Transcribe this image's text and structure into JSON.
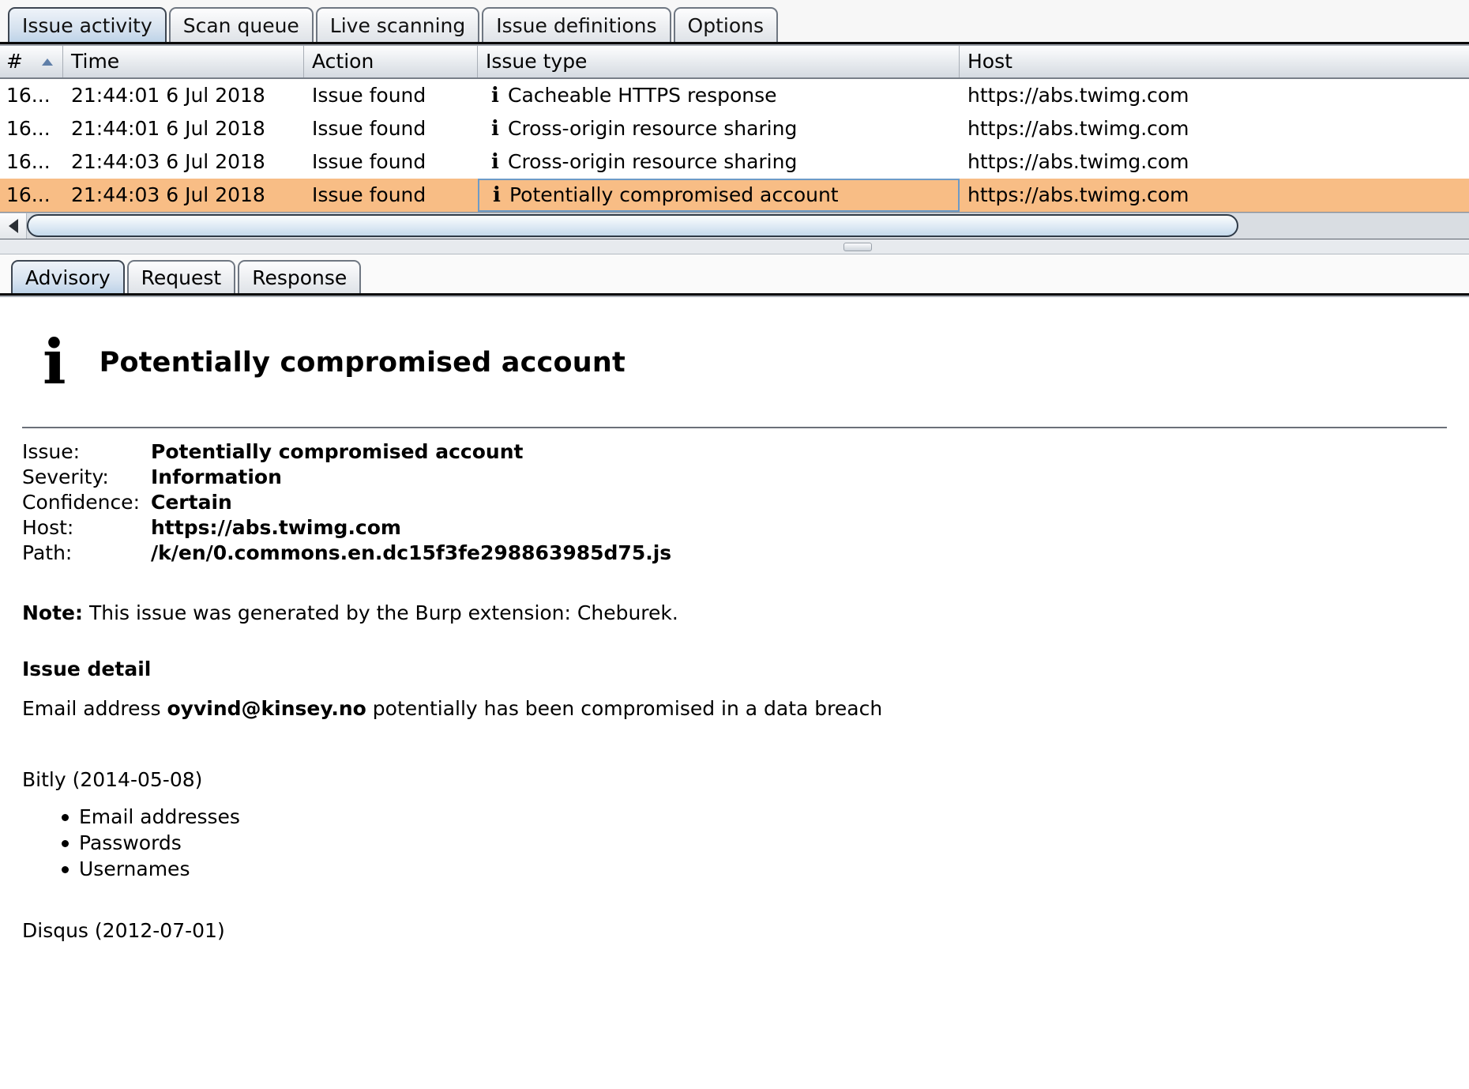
{
  "top_tabs": [
    {
      "label": "Issue activity",
      "active": true
    },
    {
      "label": "Scan queue",
      "active": false
    },
    {
      "label": "Live scanning",
      "active": false
    },
    {
      "label": "Issue definitions",
      "active": false
    },
    {
      "label": "Options",
      "active": false
    }
  ],
  "table": {
    "columns": [
      "#",
      "Time",
      "Action",
      "Issue type",
      "Host"
    ],
    "sort_column": "#",
    "sort_direction": "ascending",
    "rows": [
      {
        "num": "16...",
        "time": "21:44:01 6 Jul 2018",
        "action": "Issue found",
        "icon": "info-icon",
        "issue_type": "Cacheable HTTPS response",
        "host": "https://abs.twimg.com",
        "selected": false
      },
      {
        "num": "16...",
        "time": "21:44:01 6 Jul 2018",
        "action": "Issue found",
        "icon": "info-icon",
        "issue_type": "Cross-origin resource sharing",
        "host": "https://abs.twimg.com",
        "selected": false
      },
      {
        "num": "16...",
        "time": "21:44:03 6 Jul 2018",
        "action": "Issue found",
        "icon": "info-icon",
        "issue_type": "Cross-origin resource sharing",
        "host": "https://abs.twimg.com",
        "selected": false
      },
      {
        "num": "16...",
        "time": "21:44:03 6 Jul 2018",
        "action": "Issue found",
        "icon": "info-icon",
        "issue_type": "Potentially compromised account",
        "host": "https://abs.twimg.com",
        "selected": true
      }
    ],
    "selected_row_color": "#f8bd85",
    "focus_ring_color": "#6d9bc7"
  },
  "scrollbar": {
    "left_arrow_icon": "triangle-left-icon",
    "orientation": "horizontal"
  },
  "lower_tabs": [
    {
      "label": "Advisory",
      "active": true
    },
    {
      "label": "Request",
      "active": false
    },
    {
      "label": "Response",
      "active": false
    }
  ],
  "advisory": {
    "icon": "info-icon-large",
    "title": "Potentially compromised account",
    "meta": [
      {
        "key": "Issue:",
        "value": "Potentially compromised account"
      },
      {
        "key": "Severity:",
        "value": "Information"
      },
      {
        "key": "Confidence:",
        "value": "Certain"
      },
      {
        "key": "Host:",
        "value": "https://abs.twimg.com"
      },
      {
        "key": "Path:",
        "value": "/k/en/0.commons.en.dc15f3fe298863985d75.js"
      }
    ],
    "note_label": "Note:",
    "note_text": " This issue was generated by the Burp extension: Cheburek.",
    "issue_detail_heading": "Issue detail",
    "detail_prefix": "Email address ",
    "detail_email": "oyvind@kinsey.no",
    "detail_suffix": " potentially has been compromised in a data breach",
    "breaches": [
      {
        "title": "Bitly (2014-05-08)",
        "items": [
          "Email addresses",
          "Passwords",
          "Usernames"
        ]
      },
      {
        "title": "Disqus (2012-07-01)",
        "items": []
      }
    ]
  }
}
